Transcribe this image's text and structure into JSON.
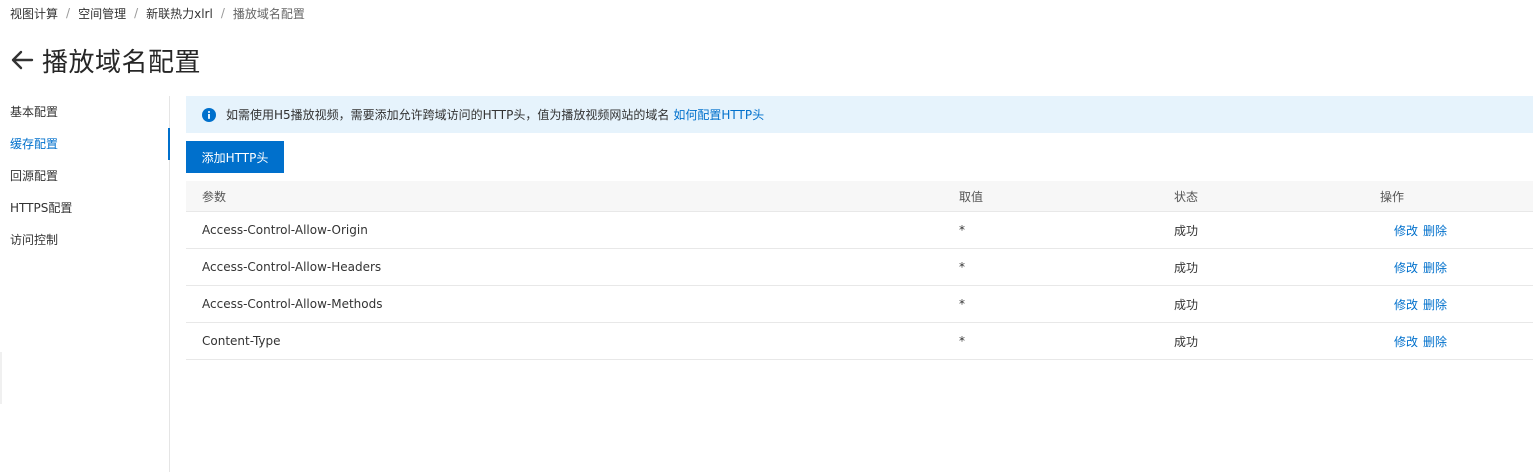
{
  "breadcrumb": [
    "视图计算",
    "空间管理",
    "新联热力xlrl",
    "播放域名配置"
  ],
  "page": {
    "title": "播放域名配置"
  },
  "sidebar": {
    "items": [
      {
        "label": "基本配置",
        "active": false
      },
      {
        "label": "缓存配置",
        "active": true
      },
      {
        "label": "回源配置",
        "active": false
      },
      {
        "label": "HTTPS配置",
        "active": false
      },
      {
        "label": "访问控制",
        "active": false
      }
    ]
  },
  "notice": {
    "text": "如需使用H5播放视频，需要添加允许跨域访问的HTTP头，值为播放视频网站的域名",
    "link": "如何配置HTTP头"
  },
  "toolbar": {
    "add_label": "添加HTTP头"
  },
  "table": {
    "headers": {
      "param": "参数",
      "value": "取值",
      "status": "状态",
      "actions": "操作"
    },
    "rows": [
      {
        "param": "Access-Control-Allow-Origin",
        "value": "*",
        "status": "成功",
        "edit": "修改",
        "delete": "删除"
      },
      {
        "param": "Access-Control-Allow-Headers",
        "value": "*",
        "status": "成功",
        "edit": "修改",
        "delete": "删除"
      },
      {
        "param": "Access-Control-Allow-Methods",
        "value": "*",
        "status": "成功",
        "edit": "修改",
        "delete": "删除"
      },
      {
        "param": "Content-Type",
        "value": "*",
        "status": "成功",
        "edit": "修改",
        "delete": "删除"
      }
    ]
  },
  "colors": {
    "accent": "#0070cc",
    "notice_bg": "#e6f3fc"
  }
}
